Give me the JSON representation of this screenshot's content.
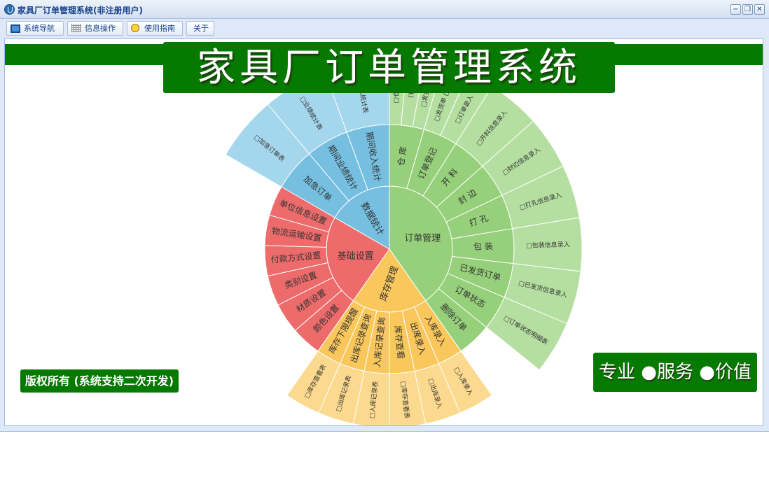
{
  "window": {
    "title": "家具厂订单管理系统(非注册用户)",
    "buttons": {
      "minimize": "−",
      "restore": "❐",
      "close": "✕"
    }
  },
  "toolbar": {
    "tabs": [
      "系统导航",
      "信息操作",
      "使用指南",
      "关于"
    ]
  },
  "banner": {
    "title": "家具厂订单管理系统"
  },
  "footer": {
    "copyright": "版权所有 (系统支持二次开发)",
    "slogan": "专业 ●服务 ●价值"
  },
  "colors": {
    "brand_green": "#067a00",
    "order_green": "#8fd170",
    "stock_yellow": "#fbc95a",
    "base_red": "#ee6a6a",
    "stats_blue": "#7fc4e4"
  },
  "sunburst": {
    "categories": [
      {
        "name": "订单管理",
        "color": "#96d07a",
        "light": "#b5dfa0",
        "children": [
          {
            "name": "仓 库",
            "leaves": [
              "□仓库信",
              "(有)",
              "□发货单"
            ]
          },
          {
            "name": "订单登记",
            "leaves": [
              "□发货单 (无记)",
              "□订单录入"
            ]
          },
          {
            "name": "开 料",
            "leaves": [
              "□开料信息录入"
            ]
          },
          {
            "name": "封 边",
            "leaves": [
              "□封边信息录入"
            ]
          },
          {
            "name": "打 孔",
            "leaves": [
              "□打孔信息录入"
            ]
          },
          {
            "name": "包 装",
            "leaves": [
              "□包装信息录入"
            ]
          },
          {
            "name": "已发货订单",
            "leaves": [
              "□已发货信息录入"
            ]
          },
          {
            "name": "订单状态",
            "leaves": [
              "□订单状态明细表"
            ]
          },
          {
            "name": "删除订单",
            "leaves": []
          }
        ]
      },
      {
        "name": "库存管理",
        "color": "#f9c75c",
        "light": "#fbd98e",
        "children": [
          {
            "name": "入库录入",
            "leaves": [
              "□入库录入"
            ]
          },
          {
            "name": "出库录入",
            "leaves": [
              "□出库录入"
            ]
          },
          {
            "name": "库存查看",
            "leaves": [
              "□库存查看表"
            ]
          },
          {
            "name": "入库记录查询",
            "leaves": [
              "□入库记录表"
            ]
          },
          {
            "name": "出库记录查询",
            "leaves": [
              "□出库记录表"
            ]
          },
          {
            "name": "库存下限提醒",
            "leaves": [
              "□库存查看表"
            ]
          }
        ]
      },
      {
        "name": "基础设置",
        "color": "#ee6b6b",
        "light": "#f07f7f",
        "children": [
          {
            "name": "颜色设置",
            "leaves": []
          },
          {
            "name": "材质设置",
            "leaves": []
          },
          {
            "name": "类别设置",
            "leaves": []
          },
          {
            "name": "付款方式设置",
            "leaves": []
          },
          {
            "name": "物流运输设置",
            "leaves": []
          },
          {
            "name": "单位信息设置",
            "leaves": []
          }
        ]
      },
      {
        "name": "数据统计",
        "color": "#76bfe0",
        "light": "#a4d6ec",
        "children": [
          {
            "name": "加急订单",
            "leaves": [
              "□加急订单表"
            ]
          },
          {
            "name": "期间业绩统计",
            "leaves": [
              "□业绩统计表"
            ]
          },
          {
            "name": "期间收入统计",
            "leaves": [
              "□收入统计表"
            ]
          }
        ]
      }
    ]
  }
}
